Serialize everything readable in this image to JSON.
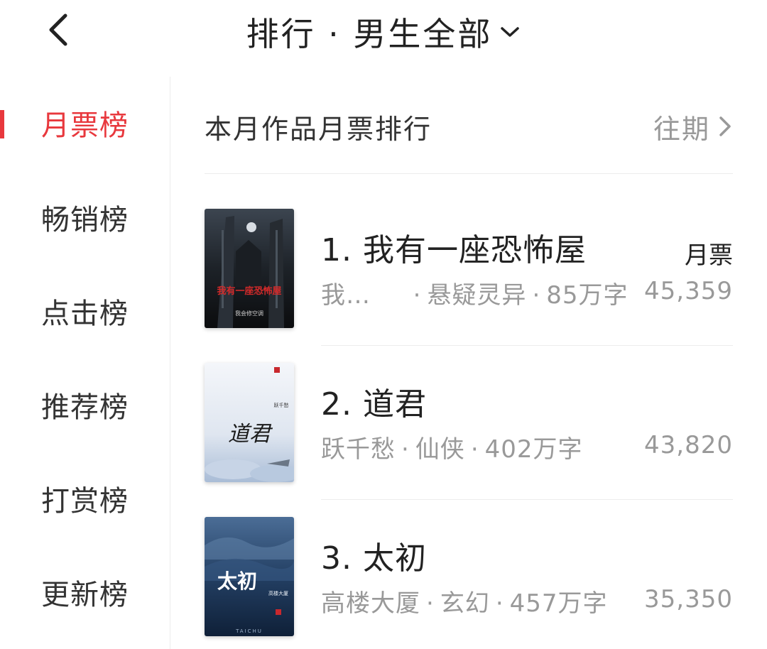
{
  "header": {
    "title": "排行 · 男生全部"
  },
  "sidebar": {
    "items": [
      {
        "label": "月票榜",
        "active": true
      },
      {
        "label": "畅销榜",
        "active": false
      },
      {
        "label": "点击榜",
        "active": false
      },
      {
        "label": "推荐榜",
        "active": false
      },
      {
        "label": "打赏榜",
        "active": false
      },
      {
        "label": "更新榜",
        "active": false
      }
    ]
  },
  "main": {
    "section_title": "本月作品月票排行",
    "history_label": "往期",
    "vote_label": "月票",
    "books": [
      {
        "title": "1. 我有一座恐怖屋",
        "author": "我…",
        "genre": "悬疑灵异",
        "words": "85万字",
        "votes": "45,359",
        "cover_title": "我有一座恐怖屋",
        "cover_author": "我会修空调"
      },
      {
        "title": "2. 道君",
        "author": "跃千愁",
        "genre": "仙侠",
        "words": "402万字",
        "votes": "43,820",
        "cover_title": "道君",
        "cover_author": "跃千愁"
      },
      {
        "title": "3. 太初",
        "author": "高楼大厦",
        "genre": "玄幻",
        "words": "457万字",
        "votes": "35,350",
        "cover_title": "太初",
        "cover_author": "高楼大厦",
        "cover_pinyin": "TAICHU"
      }
    ]
  },
  "colors": {
    "accent": "#e8383d",
    "text_primary": "#222222",
    "text_secondary": "#999999",
    "divider": "#ececec"
  }
}
